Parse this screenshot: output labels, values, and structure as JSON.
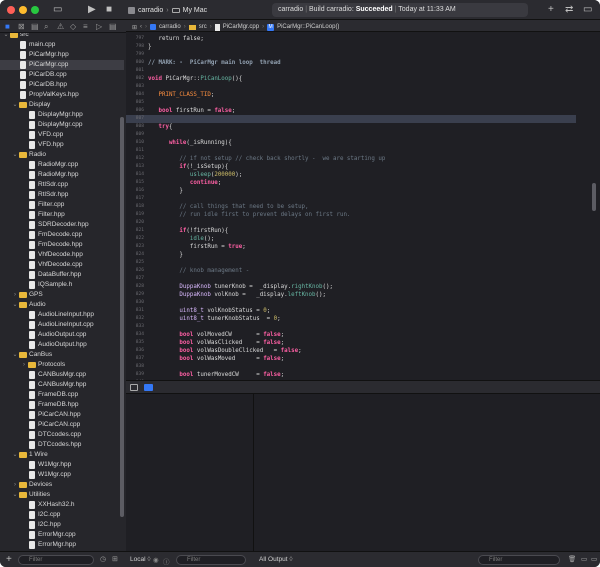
{
  "window": {
    "scheme_target": "carradio",
    "destination": "My Mac",
    "status": {
      "project": "carradio",
      "build_prefix": "Build carradio:",
      "build_result": "Succeeded",
      "build_time": "Today at 11:33 AM"
    }
  },
  "navigator": {
    "rows": [
      {
        "label": "src",
        "kind": "folder",
        "indent": 0,
        "open": true
      },
      {
        "label": "main.cpp",
        "kind": "file",
        "indent": 1
      },
      {
        "label": "PiCarMgr.hpp",
        "kind": "file",
        "indent": 1
      },
      {
        "label": "PiCarMgr.cpp",
        "kind": "file",
        "indent": 1,
        "selected": true
      },
      {
        "label": "PiCarDB.cpp",
        "kind": "file",
        "indent": 1
      },
      {
        "label": "PiCarDB.hpp",
        "kind": "file",
        "indent": 1
      },
      {
        "label": "PropValKeys.hpp",
        "kind": "file",
        "indent": 1
      },
      {
        "label": "Display",
        "kind": "folder",
        "indent": 1,
        "open": true
      },
      {
        "label": "DisplayMgr.hpp",
        "kind": "file",
        "indent": 2
      },
      {
        "label": "DisplayMgr.cpp",
        "kind": "file",
        "indent": 2
      },
      {
        "label": "VFD.cpp",
        "kind": "file",
        "indent": 2
      },
      {
        "label": "VFD.hpp",
        "kind": "file",
        "indent": 2
      },
      {
        "label": "Radio",
        "kind": "folder",
        "indent": 1,
        "open": true
      },
      {
        "label": "RadioMgr.cpp",
        "kind": "file",
        "indent": 2
      },
      {
        "label": "RadioMgr.hpp",
        "kind": "file",
        "indent": 2
      },
      {
        "label": "RtlSdr.cpp",
        "kind": "file",
        "indent": 2
      },
      {
        "label": "RtlSdr.hpp",
        "kind": "file",
        "indent": 2
      },
      {
        "label": "Filter.cpp",
        "kind": "file",
        "indent": 2
      },
      {
        "label": "Filter.hpp",
        "kind": "file",
        "indent": 2
      },
      {
        "label": "SDRDecoder.hpp",
        "kind": "file",
        "indent": 2
      },
      {
        "label": "FmDecode.cpp",
        "kind": "file",
        "indent": 2
      },
      {
        "label": "FmDecode.hpp",
        "kind": "file",
        "indent": 2
      },
      {
        "label": "VhfDecode.hpp",
        "kind": "file",
        "indent": 2
      },
      {
        "label": "VhfDecode.cpp",
        "kind": "file",
        "indent": 2
      },
      {
        "label": "DataBuffer.hpp",
        "kind": "file",
        "indent": 2
      },
      {
        "label": "IQSample.h",
        "kind": "file",
        "indent": 2
      },
      {
        "label": "GPS",
        "kind": "folder",
        "indent": 1,
        "open": false
      },
      {
        "label": "Audio",
        "kind": "folder",
        "indent": 1,
        "open": true
      },
      {
        "label": "AudioLineInput.hpp",
        "kind": "file",
        "indent": 2
      },
      {
        "label": "AudioLineInput.cpp",
        "kind": "file",
        "indent": 2
      },
      {
        "label": "AudioOutput.cpp",
        "kind": "file",
        "indent": 2
      },
      {
        "label": "AudioOutput.hpp",
        "kind": "file",
        "indent": 2
      },
      {
        "label": "CanBus",
        "kind": "folder",
        "indent": 1,
        "open": true
      },
      {
        "label": "Protocols",
        "kind": "folder",
        "indent": 2,
        "open": false
      },
      {
        "label": "CANBusMgr.cpp",
        "kind": "file",
        "indent": 2
      },
      {
        "label": "CANBusMgr.hpp",
        "kind": "file",
        "indent": 2
      },
      {
        "label": "FrameDB.cpp",
        "kind": "file",
        "indent": 2
      },
      {
        "label": "FrameDB.hpp",
        "kind": "file",
        "indent": 2
      },
      {
        "label": "PiCarCAN.hpp",
        "kind": "file",
        "indent": 2
      },
      {
        "label": "PiCarCAN.cpp",
        "kind": "file",
        "indent": 2
      },
      {
        "label": "DTCcodes.cpp",
        "kind": "file",
        "indent": 2
      },
      {
        "label": "DTCcodes.hpp",
        "kind": "file",
        "indent": 2
      },
      {
        "label": "1 Wire",
        "kind": "folder",
        "indent": 1,
        "open": true
      },
      {
        "label": "W1Mgr.hpp",
        "kind": "file",
        "indent": 2
      },
      {
        "label": "W1Mgr.cpp",
        "kind": "file",
        "indent": 2
      },
      {
        "label": "Devices",
        "kind": "folder",
        "indent": 1,
        "open": false
      },
      {
        "label": "Utilities",
        "kind": "folder",
        "indent": 1,
        "open": true
      },
      {
        "label": "XXHash32.h",
        "kind": "file",
        "indent": 2
      },
      {
        "label": "I2C.cpp",
        "kind": "file",
        "indent": 2
      },
      {
        "label": "I2C.hpp",
        "kind": "file",
        "indent": 2
      },
      {
        "label": "ErrorMgr.cpp",
        "kind": "file",
        "indent": 2
      },
      {
        "label": "ErrorMgr.hpp",
        "kind": "file",
        "indent": 2
      },
      {
        "label": "CommonDefs.hpp",
        "kind": "file",
        "indent": 2
      }
    ],
    "filter_placeholder": "Filter"
  },
  "jumpbar": {
    "items": [
      "carradio",
      "src",
      "PiCarMgr.cpp",
      "PiCarMgr::PiCanLoop()"
    ]
  },
  "editor": {
    "highlighted_line": 806,
    "lines": [
      {
        "n": 797,
        "t": [
          [
            "k-pl",
            "\treturn false;"
          ]
        ]
      },
      {
        "n": 798,
        "t": [
          [
            "k-pl",
            "}"
          ]
        ]
      },
      {
        "n": 799,
        "t": []
      },
      {
        "n": 800,
        "t": [
          [
            "k-mk",
            "// MARK: -  PiCarMgr main loop  thread"
          ]
        ]
      },
      {
        "n": 801,
        "t": []
      },
      {
        "n": 802,
        "t": [
          [
            "k-kw",
            "void "
          ],
          [
            "k-pl",
            "PiCarMgr::"
          ],
          [
            "k-fn",
            "PiCanLoop"
          ],
          [
            "k-pl",
            "(){"
          ]
        ]
      },
      {
        "n": 803,
        "t": []
      },
      {
        "n": 804,
        "t": [
          [
            "k-mac",
            "\tPRINT_CLASS_TID"
          ],
          [
            "k-pl",
            ";"
          ]
        ]
      },
      {
        "n": 805,
        "t": []
      },
      {
        "n": 806,
        "t": [
          [
            "k-kw",
            "\tbool "
          ],
          [
            "k-pl",
            "firstRun = "
          ],
          [
            "k-kw",
            "false"
          ],
          [
            "k-pl",
            ";"
          ]
        ]
      },
      {
        "n": 807,
        "t": []
      },
      {
        "n": 808,
        "t": [
          [
            "k-kw",
            "\ttry"
          ],
          [
            "k-pl",
            "{"
          ]
        ]
      },
      {
        "n": 809,
        "t": []
      },
      {
        "n": 810,
        "t": [
          [
            "k-kw",
            "\t\twhile"
          ],
          [
            "k-pl",
            "(_isRunning){"
          ]
        ]
      },
      {
        "n": 811,
        "t": []
      },
      {
        "n": 812,
        "t": [
          [
            "k-cm",
            "\t\t\t// if not setup // check back shortly -  we are starting up"
          ]
        ]
      },
      {
        "n": 813,
        "t": [
          [
            "k-kw",
            "\t\t\tif"
          ],
          [
            "k-pl",
            "(!_isSetup){"
          ]
        ]
      },
      {
        "n": 814,
        "t": [
          [
            "k-fn",
            "\t\t\t\tusleep"
          ],
          [
            "k-pl",
            "("
          ],
          [
            "k-num",
            "200000"
          ],
          [
            "k-pl",
            ");"
          ]
        ]
      },
      {
        "n": 815,
        "t": [
          [
            "k-kw",
            "\t\t\t\tcontinue"
          ],
          [
            "k-pl",
            ";"
          ]
        ]
      },
      {
        "n": 816,
        "t": [
          [
            "k-pl",
            "\t\t\t}"
          ]
        ]
      },
      {
        "n": 817,
        "t": []
      },
      {
        "n": 818,
        "t": [
          [
            "k-cm",
            "\t\t\t// call things that need to be setup,"
          ]
        ]
      },
      {
        "n": 819,
        "t": [
          [
            "k-cm",
            "\t\t\t// run idle first to prevent delays on first run."
          ]
        ]
      },
      {
        "n": 820,
        "t": []
      },
      {
        "n": 821,
        "t": [
          [
            "k-kw",
            "\t\t\tif"
          ],
          [
            "k-pl",
            "(!firstRun){"
          ]
        ]
      },
      {
        "n": 822,
        "t": [
          [
            "k-fn",
            "\t\t\t\tidle"
          ],
          [
            "k-pl",
            "();"
          ]
        ]
      },
      {
        "n": 823,
        "t": [
          [
            "k-pl",
            "\t\t\t\tfirstRun = "
          ],
          [
            "k-kw",
            "true"
          ],
          [
            "k-pl",
            ";"
          ]
        ]
      },
      {
        "n": 824,
        "t": [
          [
            "k-pl",
            "\t\t\t}"
          ]
        ]
      },
      {
        "n": 825,
        "t": []
      },
      {
        "n": 826,
        "t": [
          [
            "k-cm",
            "\t\t\t// knob management -"
          ]
        ]
      },
      {
        "n": 827,
        "t": []
      },
      {
        "n": 828,
        "t": [
          [
            "k-ty",
            "\t\t\tDuppaKnob"
          ],
          [
            "k-pl",
            " tunerKnob =  _display."
          ],
          [
            "k-fn",
            "rightKnob"
          ],
          [
            "k-pl",
            "();"
          ]
        ]
      },
      {
        "n": 829,
        "t": [
          [
            "k-ty",
            "\t\t\tDuppaKnob"
          ],
          [
            "k-pl",
            " volKnob =   _display."
          ],
          [
            "k-fn",
            "leftKnob"
          ],
          [
            "k-pl",
            "();"
          ]
        ]
      },
      {
        "n": 830,
        "t": []
      },
      {
        "n": 831,
        "t": [
          [
            "k-ty",
            "\t\t\tuint8_t"
          ],
          [
            "k-pl",
            " volKnobStatus = "
          ],
          [
            "k-num",
            "0"
          ],
          [
            "k-pl",
            ";"
          ]
        ]
      },
      {
        "n": 832,
        "t": [
          [
            "k-ty",
            "\t\t\tuint8_t"
          ],
          [
            "k-pl",
            " tunerKnobStatus  = "
          ],
          [
            "k-num",
            "0"
          ],
          [
            "k-pl",
            ";"
          ]
        ]
      },
      {
        "n": 833,
        "t": []
      },
      {
        "n": 834,
        "t": [
          [
            "k-kw",
            "\t\t\tbool "
          ],
          [
            "k-pl",
            "volMovedCW       = "
          ],
          [
            "k-kw",
            "false"
          ],
          [
            "k-pl",
            ";"
          ]
        ]
      },
      {
        "n": 835,
        "t": [
          [
            "k-kw",
            "\t\t\tbool "
          ],
          [
            "k-pl",
            "volWasClicked    = "
          ],
          [
            "k-kw",
            "false"
          ],
          [
            "k-pl",
            ";"
          ]
        ]
      },
      {
        "n": 836,
        "t": [
          [
            "k-kw",
            "\t\t\tbool "
          ],
          [
            "k-pl",
            "volWasDoubleClicked   = "
          ],
          [
            "k-kw",
            "false"
          ],
          [
            "k-pl",
            ";"
          ]
        ]
      },
      {
        "n": 837,
        "t": [
          [
            "k-kw",
            "\t\t\tbool "
          ],
          [
            "k-pl",
            "volWasMoved      = "
          ],
          [
            "k-kw",
            "false"
          ],
          [
            "k-pl",
            ";"
          ]
        ]
      },
      {
        "n": 838,
        "t": []
      },
      {
        "n": 839,
        "t": [
          [
            "k-kw",
            "\t\t\tbool "
          ],
          [
            "k-pl",
            "tunerMovedCW     = "
          ],
          [
            "k-kw",
            "false"
          ],
          [
            "k-pl",
            ";"
          ]
        ]
      },
      {
        "n": 840,
        "t": [
          [
            "k-kw",
            "\t\t\tbool "
          ],
          [
            "k-pl",
            "tunerWasClicked = "
          ],
          [
            "k-kw",
            "false"
          ],
          [
            "k-pl",
            ";"
          ]
        ]
      },
      {
        "n": 841,
        "t": [
          [
            "k-kw",
            "\t\t\tbool "
          ],
          [
            "k-pl",
            "tunerWasDoubleClicked    = "
          ],
          [
            "k-kw",
            "false"
          ],
          [
            "k-pl",
            ";"
          ]
        ]
      },
      {
        "n": 842,
        "t": [
          [
            "k-kw",
            "\t\t\tbool "
          ],
          [
            "k-pl",
            "tunerWasMoved    = "
          ],
          [
            "k-kw",
            "false"
          ],
          [
            "k-pl",
            ";"
          ]
        ]
      }
    ]
  },
  "console": {
    "left_scope": "Local",
    "left_scope_mark": "◊",
    "right_scope": "All Output",
    "right_scope_mark": "◊",
    "filter_placeholder": "Filter"
  },
  "colors": {
    "accent": "#3478f6",
    "folder": "#e8b73a",
    "success": "#ffffff"
  }
}
